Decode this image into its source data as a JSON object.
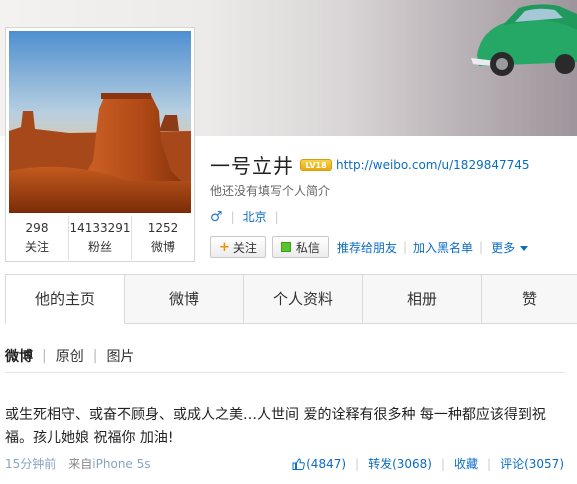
{
  "profile": {
    "username": "一号立井",
    "level_badge": "LV18",
    "url": "http://weibo.com/u/1829847745",
    "intro": "他还没有填写个人简介",
    "gender_icon": "male-icon",
    "location": "北京"
  },
  "stats": [
    {
      "num": "298",
      "label": "关注"
    },
    {
      "num": "14133291",
      "label": "粉丝"
    },
    {
      "num": "1252",
      "label": "微博"
    }
  ],
  "actions": {
    "follow": "关注",
    "message": "私信",
    "recommend": "推荐给朋友",
    "blacklist": "加入黑名单",
    "more": "更多"
  },
  "tabs": [
    "他的主页",
    "微博",
    "个人资料",
    "相册",
    "赞"
  ],
  "filters": [
    "微博",
    "原创",
    "图片"
  ],
  "post": {
    "text_line1": "或生死相守、或奋不顾身、或成人之美…人世间 爱的诠释有很多种 每一种都应该得到祝",
    "text_line2": "福。孩儿她娘 祝福你 加油!",
    "time": "15分钟前",
    "from_label": "来自",
    "device": "iPhone 5s",
    "likes": "(4847)",
    "repost": "转发(3068)",
    "favorite": "收藏",
    "comment": "评论(3057)"
  },
  "colors": {
    "link": "#0a6cc4",
    "meta": "#8aa5c2",
    "badge": "#e6a912",
    "message_icon": "#59c42d"
  }
}
